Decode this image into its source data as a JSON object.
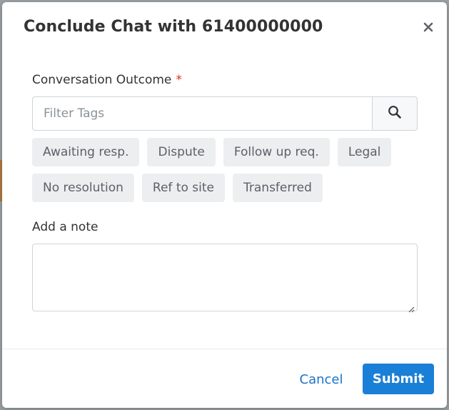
{
  "dialog": {
    "title": "Conclude Chat with 61400000000",
    "close_icon": "close-icon"
  },
  "outcome": {
    "label": "Conversation Outcome",
    "required_marker": "*",
    "filter_placeholder": "Filter Tags",
    "search_icon": "search-icon",
    "tags": [
      {
        "label": "Awaiting resp."
      },
      {
        "label": "Dispute"
      },
      {
        "label": "Follow up req."
      },
      {
        "label": "Legal"
      },
      {
        "label": "No resolution"
      },
      {
        "label": "Ref to site"
      },
      {
        "label": "Transferred"
      }
    ]
  },
  "note": {
    "label": "Add a note",
    "value": ""
  },
  "footer": {
    "cancel_label": "Cancel",
    "submit_label": "Submit"
  },
  "colors": {
    "primary": "#1a7fd6",
    "link": "#1a73c8",
    "required": "#d93025",
    "tag_bg": "#eceef0"
  }
}
